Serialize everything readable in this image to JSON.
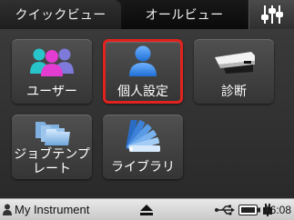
{
  "tabs": {
    "quick_view": "クイックビュー",
    "all_view": "オールビュー",
    "settings_icon": "sliders-icon"
  },
  "tiles": [
    {
      "label": "ユーザー",
      "icon": "users-icon"
    },
    {
      "label": "個人設定",
      "icon": "person-icon",
      "selected": true
    },
    {
      "label": "診断",
      "icon": "stapler-icon"
    },
    {
      "label_line1": "ジョブテンプ",
      "label_line2": "レート",
      "icon": "folders-icon"
    },
    {
      "label": "ライブラリ",
      "icon": "swatch-fan-icon"
    }
  ],
  "status": {
    "instrument": "My Instrument",
    "time": "06:08",
    "icons": [
      "person-icon",
      "eject-icon",
      "usb-icon",
      "battery-icon",
      "power-icon"
    ]
  },
  "colors": {
    "selection_border": "#e1231f",
    "tile_bg": "#454545",
    "status_bg": "#d8d8d8"
  }
}
